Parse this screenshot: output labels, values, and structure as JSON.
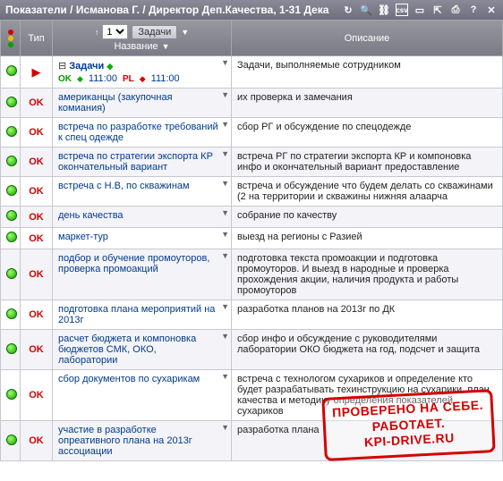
{
  "titlebar": {
    "title": "Показатели / Исманова Г. / Директор Деп.Качества, 1-31 Дека"
  },
  "header": {
    "type": "Тип",
    "name_button": "Задачи",
    "name_label": "Название",
    "page_dropdown": "1",
    "desc": "Описание"
  },
  "rows": [
    {
      "status": "green",
      "type": "flag",
      "name_main": "Задачи",
      "sub1_tag": "OK",
      "sub1_val": "111:00",
      "sub2_tag": "PL",
      "sub2_val": "111:00",
      "desc": "Задачи, выполняемые сотрудником"
    },
    {
      "status": "green",
      "type": "OK",
      "name_main": "американцы (закупочная комиания)",
      "desc": "их проверка и замечания"
    },
    {
      "status": "green",
      "type": "OK",
      "name_main": "встреча по разработке требований к спец одежде",
      "desc": "сбор РГ и обсуждение по спецодежде"
    },
    {
      "status": "green",
      "type": "OK",
      "name_main": "встреча по стратегии экспорта КР окончательный вариант",
      "desc": "встреча РГ по стратегии экспорта КР и компоновка инфо и окончательный вариант предоставление"
    },
    {
      "status": "green",
      "type": "OK",
      "name_main": "встреча с Н.В, по скважинам",
      "desc": "встреча и обсуждение что будем делать со скважинами (2 на территории и скважины нижняя алаарча"
    },
    {
      "status": "green",
      "type": "OK",
      "name_main": "день качества",
      "desc": "собрание по качеству"
    },
    {
      "status": "green",
      "type": "OK",
      "name_main": "маркет-тур",
      "desc": "выезд на регионы с Разией"
    },
    {
      "status": "green",
      "type": "OK",
      "name_main": "подбор и обучение промоуторов, проверка промоакций",
      "desc": "подготовка текста промоакции и подготовка промоуторов. И выезд в народные и проверка прохождения акции, наличия продукта и работы промоуторов"
    },
    {
      "status": "green",
      "type": "OK",
      "name_main": "подготовка плана мероприятий на 2013г",
      "desc": "разработка планов на 2013г по ДК"
    },
    {
      "status": "green",
      "type": "OK",
      "name_main": "расчет бюджета и компоновка бюджетов СМК, ОКО, лаборатории",
      "desc": "сбор инфо и обсуждение с руководителями лаборатории ОКО бюджета на год, подсчет и защита"
    },
    {
      "status": "green",
      "type": "OK",
      "name_main": "сбор документов по сухарикам",
      "desc": "встреча с технологом сухариков и определение кто будет разрабатывать техинструкцию на сухарики. план качества и методику определения показателей сухариков"
    },
    {
      "status": "green",
      "type": "OK",
      "name_main": "участие в разработке опреативного плана на 2013г ассоциации",
      "desc": "разработка плана"
    }
  ],
  "stamp": {
    "line1": "ПРОВЕРЕНО НА СЕБЕ.",
    "line2": "РАБОТАЕТ.",
    "line3": "KPI-DRIVE.RU"
  }
}
